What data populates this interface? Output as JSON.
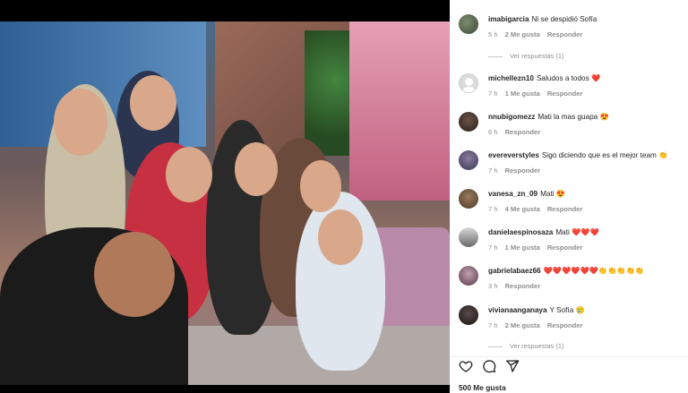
{
  "post": {
    "likes_label": "500 Me gusta"
  },
  "comments": [
    {
      "user": "imabigarcia",
      "text": "Ni se despidió Sofía",
      "time": "5 h",
      "likes": "2 Me gusta",
      "reply": "Responder"
    },
    {
      "user": "michellezn10",
      "text": "Saludos a todos ❤️",
      "time": "7 h",
      "likes": "1 Me gusta",
      "reply": "Responder"
    },
    {
      "user": "nnubigomezz",
      "text": "Mati la mas guapa 😍",
      "time": "6 h",
      "likes": "",
      "reply": "Responder"
    },
    {
      "user": "evereverstyles",
      "text": "Sigo diciendo que es el mejor team 👏",
      "time": "7 h",
      "likes": "",
      "reply": "Responder"
    },
    {
      "user": "vanesa_zn_09",
      "text": "Mati 😍",
      "time": "7 h",
      "likes": "4 Me gusta",
      "reply": "Responder"
    },
    {
      "user": "danielaespinosaza",
      "text": "Mati ❤️❤️❤️",
      "time": "7 h",
      "likes": "1 Me gusta",
      "reply": "Responder"
    },
    {
      "user": "gabrielabaez66",
      "text": "❤️❤️❤️❤️❤️❤️👏👏👏👏👏",
      "time": "3 h",
      "likes": "",
      "reply": "Responder"
    },
    {
      "user": "vivianaanganaya",
      "text": "Y Sofía 🥲",
      "time": "7 h",
      "likes": "2 Me gusta",
      "reply": "Responder"
    }
  ],
  "replies": [
    {
      "label": "Ver respuestas (1)"
    },
    {
      "label": "Ver respuestas (1)"
    }
  ],
  "icons": {
    "like": "heart-icon",
    "comment": "comment-icon",
    "share": "share-icon"
  },
  "colors": {
    "text": "#262626",
    "meta": "#8e8e8e",
    "background": "#ffffff"
  }
}
